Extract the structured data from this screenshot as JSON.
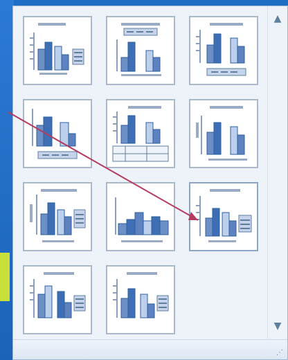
{
  "icons": {
    "scroll_up": "▲",
    "scroll_down": "▼",
    "grip": "⋰"
  },
  "colors": {
    "accent": "#2f5f9e",
    "pointer": "#b43a5e"
  }
}
